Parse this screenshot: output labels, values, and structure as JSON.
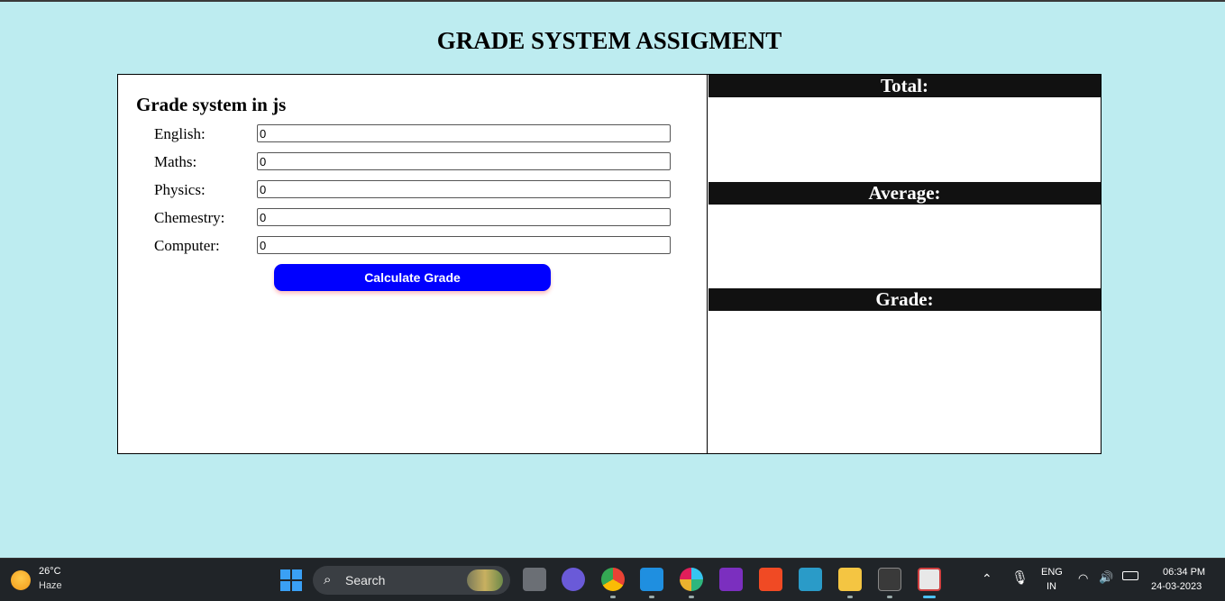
{
  "page": {
    "title": "GRADE SYSTEM ASSIGMENT"
  },
  "form": {
    "title": "Grade system in js",
    "fields": [
      {
        "label": "English:",
        "value": "0"
      },
      {
        "label": "Maths:",
        "value": "0"
      },
      {
        "label": "Physics:",
        "value": "0"
      },
      {
        "label": "Chemestry:",
        "value": "0"
      },
      {
        "label": "Computer:",
        "value": "0"
      }
    ],
    "button_label": "Calculate Grade"
  },
  "results": {
    "total_label": "Total:",
    "average_label": "Average:",
    "grade_label": "Grade:"
  },
  "taskbar": {
    "weather_temp": "26°C",
    "weather_desc": "Haze",
    "search_label": "Search",
    "lang": "ENG",
    "region": "IN",
    "time": "06:34 PM",
    "date": "24-03-2023",
    "apps": [
      "windows-start-icon",
      "task-view-icon",
      "teams-chat-icon",
      "chrome-icon",
      "vscode-icon",
      "slack-icon",
      "onenote-icon",
      "brave-icon",
      "game-icon",
      "file-explorer-icon",
      "terminal-icon",
      "snipping-tool-icon"
    ]
  },
  "colors": {
    "page_bg": "#bdecf0",
    "button": "#0000ff",
    "result_header": "#111111"
  }
}
